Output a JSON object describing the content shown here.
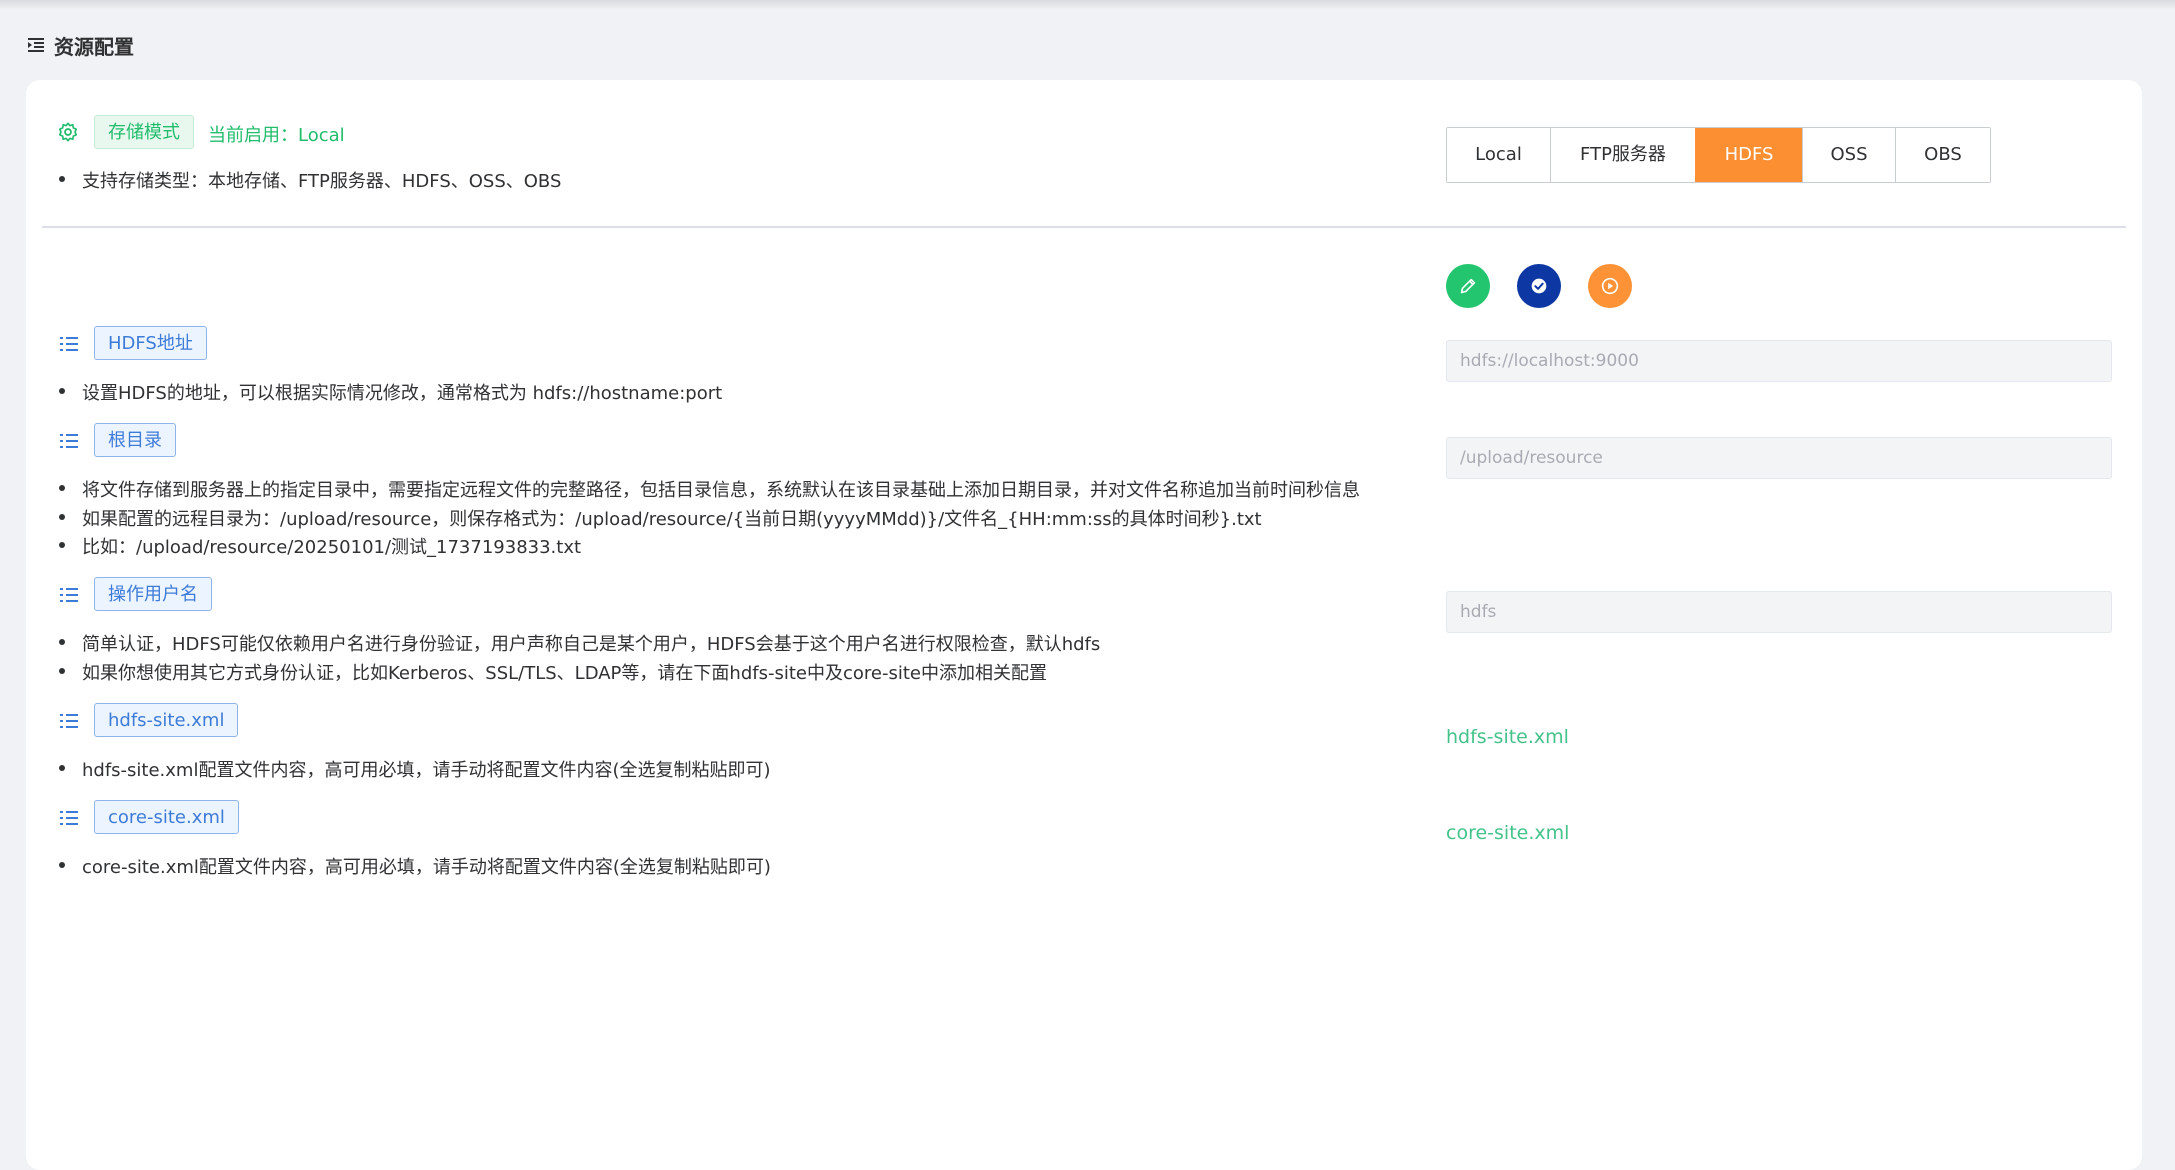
{
  "header": {
    "title": "资源配置",
    "icon": "indent-menu-icon"
  },
  "storage": {
    "tag": "存储模式",
    "current": "当前启用：Local",
    "supported": "支持存储类型：本地存储、FTP服务器、HDFS、OSS、OBS",
    "icon": "gear-icon"
  },
  "modes": [
    "Local",
    "FTP服务器",
    "HDFS",
    "OSS",
    "OBS"
  ],
  "active_mode": "HDFS",
  "actions": [
    {
      "name": "edit-button",
      "icon": "pencil-icon",
      "color": "#23c56f"
    },
    {
      "name": "confirm-button",
      "icon": "check-circle-icon",
      "color": "#0d38a4"
    },
    {
      "name": "run-button",
      "icon": "play-circle-icon",
      "color": "#fd9236"
    }
  ],
  "sections": [
    {
      "tag": "HDFS地址",
      "lines": [
        "设置HDFS的地址，可以根据实际情况修改，通常格式为 hdfs://hostname:port"
      ],
      "placeholder": "hdfs://localhost:9000"
    },
    {
      "tag": "根目录",
      "lines": [
        "将文件存储到服务器上的指定目录中，需要指定远程文件的完整路径，包括目录信息，系统默认在该目录基础上添加日期目录，并对文件名称追加当前时间秒信息",
        "如果配置的远程目录为：/upload/resource，则保存格式为：/upload/resource/{当前日期(yyyyMMdd)}/文件名_{HH:mm:ss的具体时间秒}.txt",
        "比如：/upload/resource/20250101/测试_1737193833.txt"
      ],
      "placeholder": "/upload/resource"
    },
    {
      "tag": "操作用户名",
      "lines": [
        "简单认证，HDFS可能仅依赖用户名进行身份验证，用户声称自己是某个用户，HDFS会基于这个用户名进行权限检查，默认hdfs",
        "如果你想使用其它方式身份认证，比如Kerberos、SSL/TLS、LDAP等，请在下面hdfs-site中及core-site中添加相关配置"
      ],
      "placeholder": "hdfs"
    },
    {
      "tag": "hdfs-site.xml",
      "lines": [
        "hdfs-site.xml配置文件内容，高可用必填，请手动将配置文件内容(全选复制粘贴即可)"
      ],
      "link": "hdfs-site.xml"
    },
    {
      "tag": "core-site.xml",
      "lines": [
        "core-site.xml配置文件内容，高可用必填，请手动将配置文件内容(全选复制粘贴即可)"
      ],
      "link": "core-site.xml"
    }
  ],
  "colors": {
    "accent": "#fd8f33",
    "green": "#21bd6c",
    "blue_tag": "#3d7bd9",
    "link": "#43c38a"
  }
}
